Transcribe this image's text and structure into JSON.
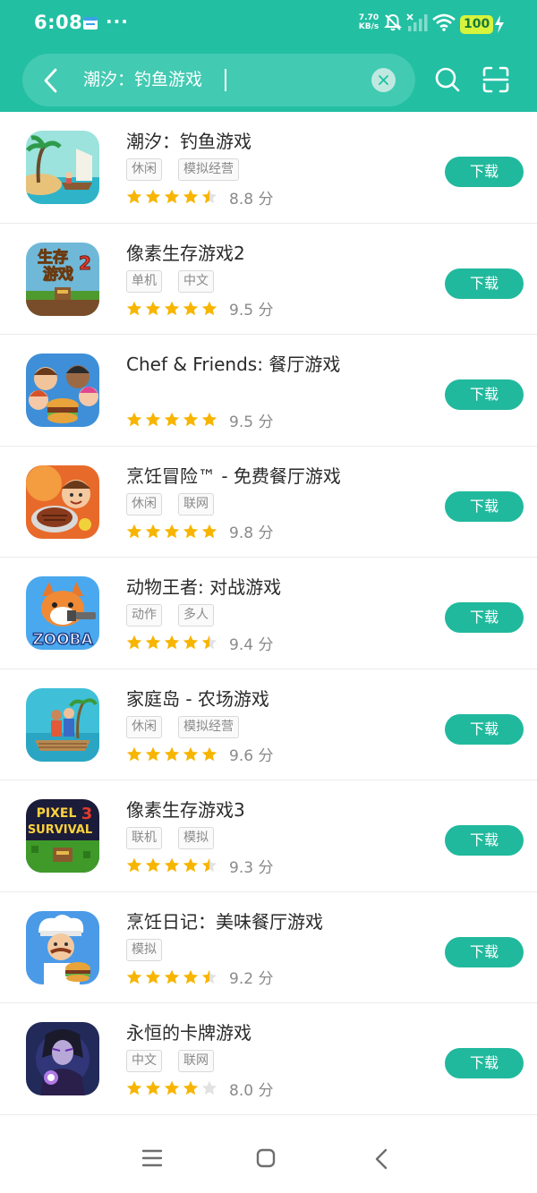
{
  "status_bar": {
    "time": "6:08",
    "net_speed_value": "7.70",
    "net_speed_unit": "KB/s",
    "battery": "100"
  },
  "search": {
    "query": "潮汐：钓鱼游戏"
  },
  "apps": [
    {
      "title": "潮汐：钓鱼游戏",
      "tags": [
        "休闲",
        "模拟经营"
      ],
      "stars": 4.5,
      "score": "8.8 分",
      "icon": "tidal-fishing-icon",
      "button": "下载"
    },
    {
      "title": "像素生存游戏2",
      "tags": [
        "单机",
        "中文"
      ],
      "stars": 5,
      "score": "9.5 分",
      "icon": "pixel-survival-2-icon",
      "button": "下载"
    },
    {
      "title": "Chef & Friends: 餐厅游戏",
      "tags": [],
      "stars": 5,
      "score": "9.5 分",
      "icon": "chef-friends-icon",
      "button": "下载"
    },
    {
      "title": "烹饪冒险™ - 免费餐厅游戏",
      "tags": [
        "休闲",
        "联网"
      ],
      "stars": 5,
      "score": "9.8 分",
      "icon": "cooking-adventure-icon",
      "button": "下载"
    },
    {
      "title": "动物王者: 对战游戏",
      "tags": [
        "动作",
        "多人"
      ],
      "stars": 4.5,
      "score": "9.4 分",
      "icon": "zooba-icon",
      "button": "下载"
    },
    {
      "title": "家庭岛 - 农场游戏",
      "tags": [
        "休闲",
        "模拟经营"
      ],
      "stars": 5,
      "score": "9.6 分",
      "icon": "family-island-icon",
      "button": "下载"
    },
    {
      "title": "像素生存游戏3",
      "tags": [
        "联机",
        "模拟"
      ],
      "stars": 4.5,
      "score": "9.3 分",
      "icon": "pixel-survival-3-icon",
      "button": "下载"
    },
    {
      "title": "烹饪日记：美味餐厅游戏",
      "tags": [
        "模拟"
      ],
      "stars": 4.5,
      "score": "9.2 分",
      "icon": "cooking-diary-icon",
      "button": "下载"
    },
    {
      "title": "永恒的卡牌游戏",
      "tags": [
        "中文",
        "联网"
      ],
      "stars": 4,
      "score": "8.0 分",
      "icon": "eternal-card-icon",
      "button": "下载"
    }
  ],
  "icon_labels": {
    "pixel_survival_2": [
      "生存",
      "游戏",
      "2"
    ],
    "zooba": "ZOOBA",
    "pixel_survival_3": [
      "PIXEL",
      "SURVIVAL",
      "3"
    ]
  },
  "colors": {
    "accent": "#22bfa3",
    "button": "#21b99d",
    "star": "#f7b500",
    "star_empty": "#e2e2e2",
    "battery": "#d7f33c"
  }
}
